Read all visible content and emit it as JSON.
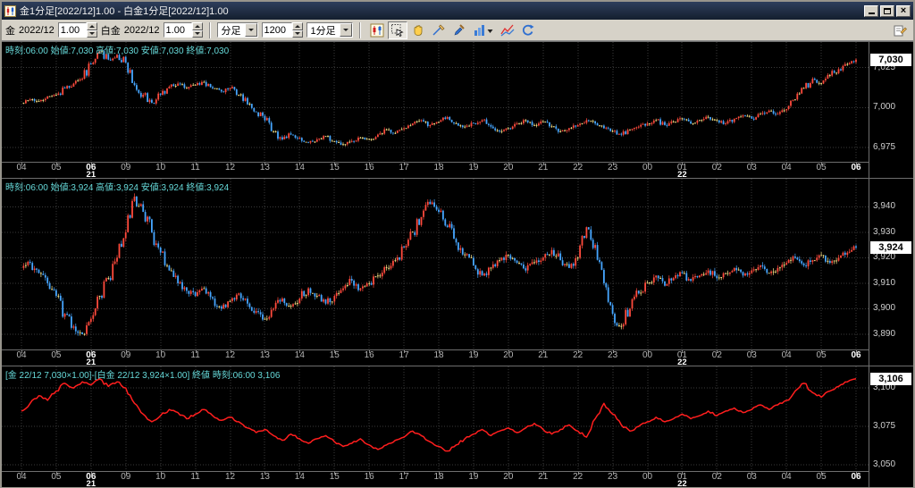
{
  "window": {
    "title": "金1分足[2022/12]1.00 - 白金1分足[2022/12]1.00",
    "buttons": [
      "minimize-button",
      "restore-button",
      "close-button"
    ]
  },
  "toolbar": {
    "gold_label": "金",
    "gold_contract": "2022/12",
    "gold_multiplier": "1.00",
    "platinum_label": "白金",
    "platinum_contract": "2022/12",
    "platinum_multiplier": "1.00",
    "period_type": "分足",
    "bar_count": "1200",
    "interval": "1分足",
    "icons": [
      {
        "name": "candlestick-chart-icon",
        "selected": false
      },
      {
        "name": "select-mode-icon",
        "selected": true
      },
      {
        "name": "pan-hand-icon",
        "selected": false
      },
      {
        "name": "trendline-icon",
        "selected": false
      },
      {
        "name": "draw-tool-icon",
        "selected": false
      },
      {
        "name": "indicator-menu-icon",
        "selected": false
      },
      {
        "name": "chart-style-icon",
        "selected": false
      },
      {
        "name": "refresh-icon",
        "selected": false
      }
    ],
    "right_icon": {
      "name": "chart-settings-icon"
    }
  },
  "x_axis": {
    "hours": [
      "04",
      "05",
      "06",
      "09",
      "10",
      "11",
      "12",
      "13",
      "14",
      "15",
      "16",
      "17",
      "18",
      "19",
      "20",
      "21",
      "22",
      "23",
      "00",
      "01",
      "02",
      "03",
      "04",
      "05",
      "06"
    ],
    "bold_indices": [
      2,
      24
    ],
    "dates": [
      {
        "text": "21",
        "pos": 2
      },
      {
        "text": "22",
        "pos": 19
      }
    ]
  },
  "colors": {
    "up": "#ff4a3c",
    "down": "#46a6ff",
    "flat": "#ffe98c",
    "spread_line": "#ff1e1e",
    "info_text": "#66d9d9",
    "grid": "#3a3a3a"
  },
  "chart_data": [
    {
      "name": "gold-1min",
      "type": "candlestick",
      "info": "時刻:06:00 始値:7,030 高値:7,030 安値:7,030 終値:7,030",
      "ylim": [
        6966,
        7041
      ],
      "y_ticks": [
        {
          "v": 7025,
          "label": "7,025"
        },
        {
          "v": 7000,
          "label": "7,000"
        },
        {
          "v": 6975,
          "label": "6,975"
        }
      ],
      "last_label": "7,030",
      "closes": [
        7003,
        7005,
        7004,
        7007,
        7008,
        7012,
        7015,
        7018,
        7027,
        7035,
        7030,
        7033,
        7028,
        7014,
        7008,
        7003,
        7008,
        7013,
        7015,
        7012,
        7014,
        7016,
        7012,
        7010,
        7012,
        7008,
        7002,
        6997,
        6992,
        6985,
        6980,
        6983,
        6981,
        6978,
        6980,
        6982,
        6979,
        6977,
        6979,
        6981,
        6980,
        6983,
        6986,
        6984,
        6987,
        6990,
        6992,
        6989,
        6991,
        6994,
        6990,
        6988,
        6990,
        6992,
        6988,
        6985,
        6987,
        6990,
        6992,
        6989,
        6991,
        6988,
        6985,
        6987,
        6989,
        6992,
        6990,
        6987,
        6985,
        6983,
        6986,
        6988,
        6990,
        6992,
        6989,
        6991,
        6993,
        6990,
        6992,
        6994,
        6992,
        6990,
        6993,
        6995,
        6993,
        6996,
        6998,
        6996,
        6999,
        7005,
        7012,
        7018,
        7015,
        7020,
        7024,
        7027,
        7030
      ]
    },
    {
      "name": "platinum-1min",
      "type": "candlestick",
      "info": "時刻:06:00 始値:3,924 高値:3,924 安値:3,924 終値:3,924",
      "ylim": [
        3884,
        3951
      ],
      "y_ticks": [
        {
          "v": 3940,
          "label": "3,940"
        },
        {
          "v": 3930,
          "label": "3,930"
        },
        {
          "v": 3920,
          "label": "3,920"
        },
        {
          "v": 3910,
          "label": "3,910"
        },
        {
          "v": 3900,
          "label": "3,900"
        },
        {
          "v": 3890,
          "label": "3,890"
        }
      ],
      "last_label": "3,924",
      "closes": [
        3916,
        3918,
        3914,
        3910,
        3905,
        3898,
        3893,
        3890,
        3896,
        3905,
        3912,
        3920,
        3930,
        3944,
        3938,
        3930,
        3922,
        3915,
        3910,
        3907,
        3905,
        3908,
        3904,
        3900,
        3903,
        3906,
        3902,
        3899,
        3896,
        3900,
        3904,
        3901,
        3904,
        3908,
        3905,
        3902,
        3905,
        3908,
        3911,
        3908,
        3910,
        3913,
        3916,
        3919,
        3924,
        3930,
        3936,
        3941,
        3938,
        3932,
        3926,
        3921,
        3917,
        3913,
        3916,
        3919,
        3921,
        3918,
        3915,
        3918,
        3920,
        3923,
        3919,
        3916,
        3920,
        3932,
        3925,
        3910,
        3898,
        3893,
        3900,
        3906,
        3910,
        3913,
        3909,
        3912,
        3914,
        3911,
        3913,
        3915,
        3912,
        3914,
        3916,
        3913,
        3915,
        3917,
        3914,
        3916,
        3918,
        3920,
        3917,
        3919,
        3921,
        3918,
        3920,
        3922,
        3924
      ]
    },
    {
      "name": "gold-platinum-spread",
      "type": "line",
      "info": "[金 22/12 7,030×1.00]-[白金 22/12 3,924×1.00] 終値 時刻:06:00 3,106",
      "ylim": [
        3046,
        3114
      ],
      "y_ticks": [
        {
          "v": 3100,
          "label": "3,100"
        },
        {
          "v": 3075,
          "label": "3,075"
        },
        {
          "v": 3050,
          "label": "3,050"
        }
      ],
      "last_label": "3,106",
      "closes": [
        3085,
        3090,
        3095,
        3092,
        3098,
        3103,
        3100,
        3104,
        3102,
        3106,
        3101,
        3104,
        3100,
        3090,
        3083,
        3078,
        3082,
        3086,
        3084,
        3080,
        3083,
        3086,
        3082,
        3079,
        3081,
        3078,
        3074,
        3071,
        3073,
        3069,
        3066,
        3070,
        3067,
        3064,
        3067,
        3069,
        3065,
        3062,
        3064,
        3067,
        3063,
        3060,
        3063,
        3066,
        3068,
        3072,
        3069,
        3065,
        3062,
        3059,
        3063,
        3067,
        3070,
        3073,
        3069,
        3072,
        3074,
        3071,
        3074,
        3077,
        3073,
        3070,
        3073,
        3076,
        3072,
        3068,
        3080,
        3090,
        3083,
        3076,
        3072,
        3075,
        3078,
        3081,
        3078,
        3080,
        3083,
        3080,
        3082,
        3085,
        3082,
        3085,
        3087,
        3084,
        3086,
        3089,
        3086,
        3089,
        3092,
        3098,
        3103,
        3097,
        3094,
        3098,
        3101,
        3104,
        3106
      ]
    }
  ]
}
